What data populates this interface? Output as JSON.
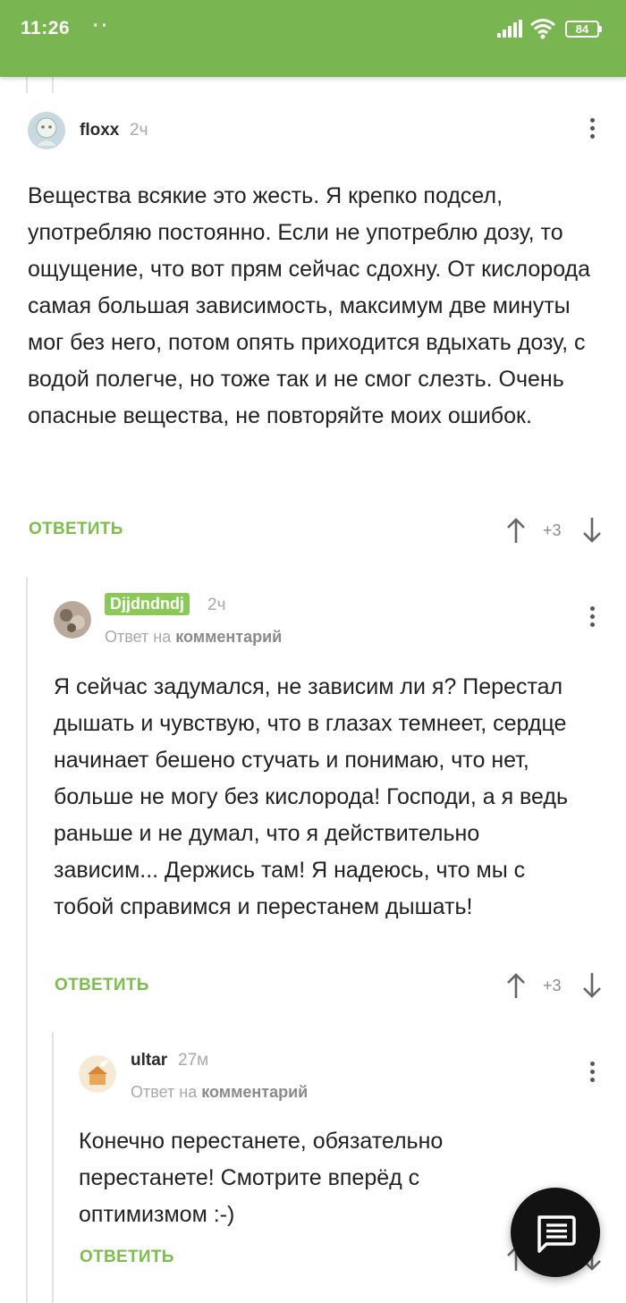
{
  "status_bar": {
    "time": "11:26",
    "dots": "··",
    "battery": "84"
  },
  "colors": {
    "brand_green": "#79b551",
    "reply_green": "#7bbf4a",
    "badge_green": "#8ac858"
  },
  "comments": [
    {
      "username": "floxx",
      "time_ago": "2ч",
      "text": "Вещества всякие это жесть. Я крепко подсел, употребляю постоянно. Если не употреблю дозу, то ощущение, что вот прям сейчас сдохну. От кислорода самая большая зависимость, максимум две минуты мог без него, потом опять приходится вдыхать дозу, с водой полегче, но тоже так и не смог слезть. Очень опасные вещества, не повторяйте моих ошибок.",
      "reply_label": "ОТВЕТИТЬ",
      "rating": "+3"
    },
    {
      "username": "Djjdndndj",
      "time_ago": "2ч",
      "reply_prefix": "Ответ на",
      "reply_target": "комментарий",
      "text": "Я сейчас задумался, не зависим ли я? Перестал дышать и чувствую, что в глазах темнеет, сердце начинает бешено стучать и понимаю, что нет, больше не могу без кислорода! Господи, а я ведь раньше и не думал, что я действительно зависим... Держись там! Я надеюсь, что мы с тобой справимся и перестанем дышать!",
      "reply_label": "ОТВЕТИТЬ",
      "rating": "+3"
    },
    {
      "username": "ultar",
      "time_ago": "27м",
      "reply_prefix": "Ответ на",
      "reply_target": "комментарий",
      "text": "Конечно перестанете, обязательно перестанете! Смотрите вперёд с оптимизмом :-)",
      "reply_label": "ОТВЕТИТЬ"
    }
  ],
  "icons": {
    "more": "more-vertical-icon",
    "upvote": "arrow-up-icon",
    "downvote": "arrow-down-icon",
    "fab": "comment-icon"
  }
}
